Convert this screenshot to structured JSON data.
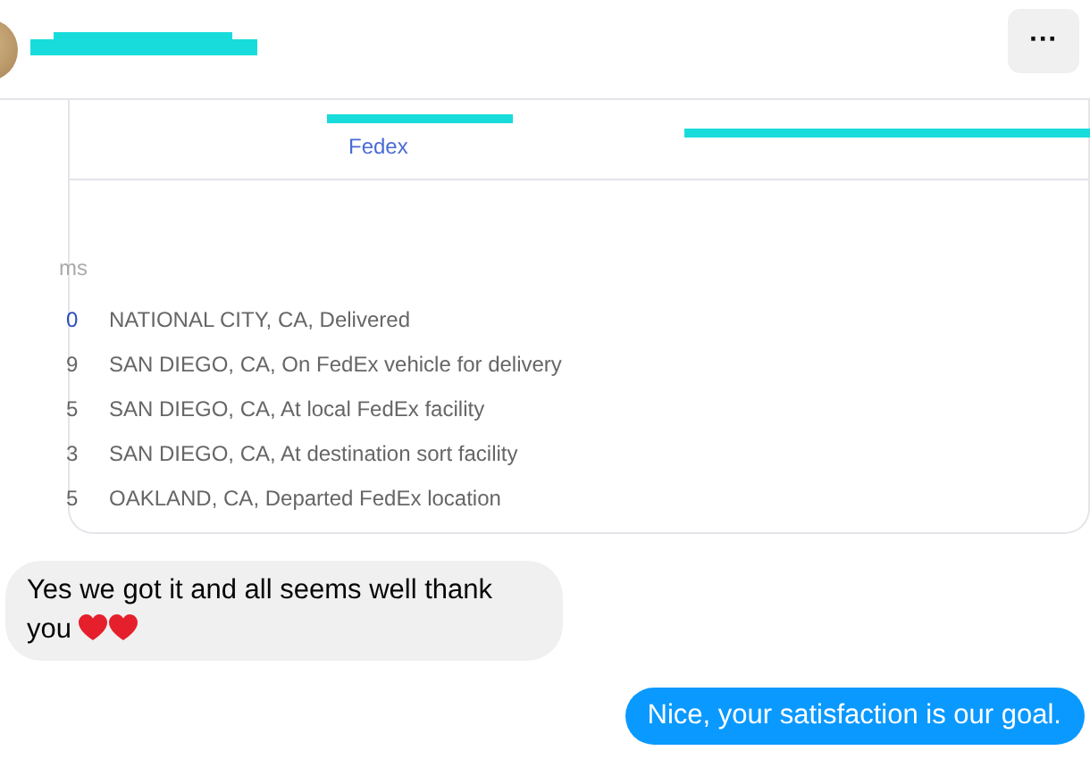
{
  "header": {
    "more_button": "···"
  },
  "shipment_card": {
    "carrier_link": "Fedex",
    "column_heading_fragment": "ms",
    "tracking_rows": [
      {
        "time_fragment": "0",
        "event": "NATIONAL CITY, CA, Delivered",
        "selected": true
      },
      {
        "time_fragment": "9",
        "event": "SAN DIEGO, CA, On FedEx vehicle for delivery",
        "selected": false
      },
      {
        "time_fragment": "5",
        "event": "SAN DIEGO, CA, At local FedEx facility",
        "selected": false
      },
      {
        "time_fragment": "3",
        "event": "SAN DIEGO, CA, At destination sort facility",
        "selected": false
      },
      {
        "time_fragment": "5",
        "event": "OAKLAND, CA, Departed FedEx location",
        "selected": false
      }
    ]
  },
  "messages": [
    {
      "kind": "received",
      "text": "Yes we got it and all seems well thank you",
      "emoji": [
        {
          "kind": "heart"
        },
        {
          "kind": "heart"
        }
      ]
    },
    {
      "kind": "sent",
      "text": "Nice, your satisfaction is our goal."
    }
  ]
}
